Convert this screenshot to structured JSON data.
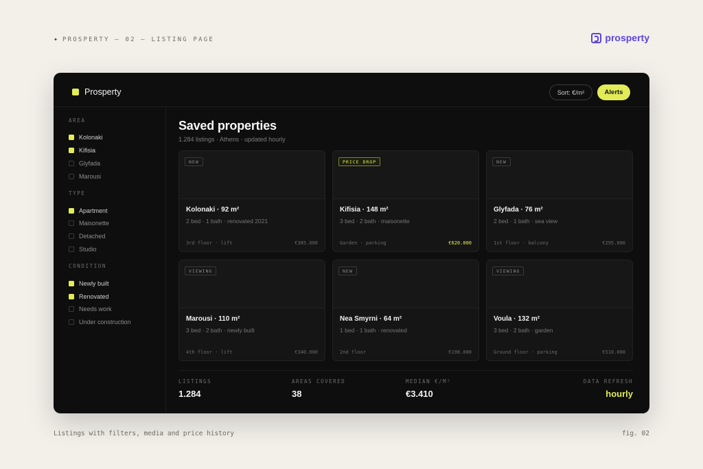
{
  "page": {
    "label": "PROSPERTY — 02 — LISTING PAGE",
    "brand": "prosperty",
    "caption": "Listings with filters, media and price history",
    "fig": "fig. 02"
  },
  "app": {
    "name": "Prosperty",
    "sort_label": "Sort: €/m²",
    "alerts_label": "Alerts"
  },
  "colors": {
    "accent": "#e1ec58",
    "brand": "#5b45e0",
    "background": "#0e0e0e"
  },
  "filters": [
    {
      "title": "AREA",
      "items": [
        {
          "label": "Kolonaki",
          "checked": true
        },
        {
          "label": "Kifisia",
          "checked": true
        },
        {
          "label": "Glyfada",
          "checked": false
        },
        {
          "label": "Marousi",
          "checked": false
        }
      ]
    },
    {
      "title": "TYPE",
      "items": [
        {
          "label": "Apartment",
          "checked": true
        },
        {
          "label": "Maisonette",
          "checked": false
        },
        {
          "label": "Detached",
          "checked": false
        },
        {
          "label": "Studio",
          "checked": false
        }
      ]
    },
    {
      "title": "CONDITION",
      "items": [
        {
          "label": "Newly built",
          "checked": true
        },
        {
          "label": "Renovated",
          "checked": true
        },
        {
          "label": "Needs work",
          "checked": false
        },
        {
          "label": "Under construction",
          "checked": false
        }
      ]
    }
  ],
  "main": {
    "title": "Saved properties",
    "subtitle": "1.284 listings · Athens · updated hourly"
  },
  "cards": [
    {
      "badge": "NEW",
      "highlight": false,
      "title": "Kolonaki · 92 m²",
      "desc": "2 bed · 1 bath · renovated 2021",
      "meta": "3rd floor · lift",
      "price": "€385.000"
    },
    {
      "badge": "PRICE DROP",
      "highlight": true,
      "title": "Kifisia · 148 m²",
      "desc": "3 bed · 2 bath · maisonette",
      "meta": "Garden · parking",
      "price": "€620.000"
    },
    {
      "badge": "NEW",
      "highlight": false,
      "title": "Glyfada · 76 m²",
      "desc": "2 bed · 1 bath · sea view",
      "meta": "1st floor · balcony",
      "price": "€295.000"
    },
    {
      "badge": "VIEWING",
      "highlight": false,
      "title": "Marousi · 110 m²",
      "desc": "3 bed · 2 bath · newly built",
      "meta": "4th floor · lift",
      "price": "€340.000"
    },
    {
      "badge": "NEW",
      "highlight": false,
      "title": "Nea Smyrni · 64 m²",
      "desc": "1 bed · 1 bath · renovated",
      "meta": "2nd floor",
      "price": "€198.000"
    },
    {
      "badge": "VIEWING",
      "highlight": false,
      "title": "Voula · 132 m²",
      "desc": "3 bed · 2 bath · garden",
      "meta": "Ground floor · parking",
      "price": "€510.000"
    }
  ],
  "stats": [
    {
      "label": "LISTINGS",
      "value": "1.284"
    },
    {
      "label": "AREAS COVERED",
      "value": "38"
    },
    {
      "label": "MEDIAN €/M²",
      "value": "€3.410"
    },
    {
      "label": "DATA REFRESH",
      "value": "hourly"
    }
  ]
}
